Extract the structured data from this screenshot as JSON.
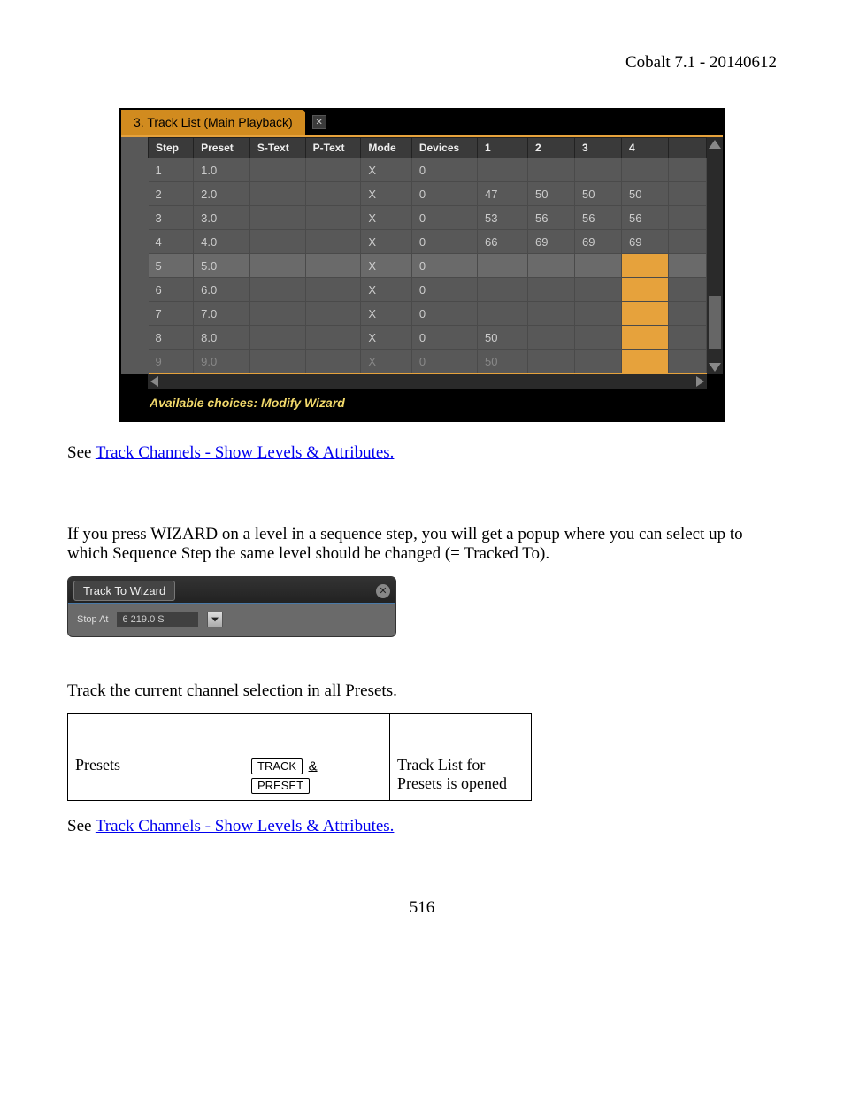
{
  "header": {
    "doc_id": "Cobalt 7.1 - 20140612"
  },
  "tracklist": {
    "title": "3. Track List (Main Playback)",
    "columns": [
      "Step",
      "Preset",
      "S-Text",
      "P-Text",
      "Mode",
      "Devices",
      "1",
      "2",
      "3",
      "4"
    ],
    "rows": [
      {
        "step": "1",
        "preset": "1.0",
        "stext": "",
        "ptext": "",
        "mode": "X",
        "devices": "0",
        "c1": "",
        "c2": "",
        "c3": "",
        "c4": "",
        "selected": false,
        "hl4": false
      },
      {
        "step": "2",
        "preset": "2.0",
        "stext": "",
        "ptext": "",
        "mode": "X",
        "devices": "0",
        "c1": "47",
        "c2": "50",
        "c3": "50",
        "c4": "50",
        "selected": false,
        "hl4": false
      },
      {
        "step": "3",
        "preset": "3.0",
        "stext": "",
        "ptext": "",
        "mode": "X",
        "devices": "0",
        "c1": "53",
        "c2": "56",
        "c3": "56",
        "c4": "56",
        "selected": false,
        "hl4": false
      },
      {
        "step": "4",
        "preset": "4.0",
        "stext": "",
        "ptext": "",
        "mode": "X",
        "devices": "0",
        "c1": "66",
        "c2": "69",
        "c3": "69",
        "c4": "69",
        "selected": false,
        "hl4": false
      },
      {
        "step": "5",
        "preset": "5.0",
        "stext": "",
        "ptext": "",
        "mode": "X",
        "devices": "0",
        "c1": "",
        "c2": "",
        "c3": "",
        "c4": "",
        "selected": true,
        "hl4": true
      },
      {
        "step": "6",
        "preset": "6.0",
        "stext": "",
        "ptext": "",
        "mode": "X",
        "devices": "0",
        "c1": "",
        "c2": "",
        "c3": "",
        "c4": "",
        "selected": false,
        "hl4": true
      },
      {
        "step": "7",
        "preset": "7.0",
        "stext": "",
        "ptext": "",
        "mode": "X",
        "devices": "0",
        "c1": "",
        "c2": "",
        "c3": "",
        "c4": "",
        "selected": false,
        "hl4": true
      },
      {
        "step": "8",
        "preset": "8.0",
        "stext": "",
        "ptext": "",
        "mode": "X",
        "devices": "0",
        "c1": "50",
        "c2": "",
        "c3": "",
        "c4": "",
        "selected": false,
        "hl4": true
      },
      {
        "step": "9",
        "preset": "9.0",
        "stext": "",
        "ptext": "",
        "mode": "X",
        "devices": "0",
        "c1": "50",
        "c2": "",
        "c3": "",
        "c4": "",
        "selected": false,
        "hl4": true,
        "last": true
      }
    ],
    "footer": "Available choices: Modify Wizard"
  },
  "paragraphs": {
    "see_prefix": "See ",
    "see_link": "Track Channels - Show Levels & Attributes.",
    "wizard_intro": "If you press WIZARD on a level in a sequence step, you will get a popup where you can select up to which Sequence Step the same level should be changed (= Tracked To).",
    "presets_intro": "Track the current channel selection in all Presets."
  },
  "wizard_dialog": {
    "title": "Track To Wizard",
    "label": "Stop At",
    "value": "6  219.0 S"
  },
  "action_table": {
    "row_label": "Presets",
    "key1": "TRACK",
    "amp": "&",
    "key2": "PRESET",
    "result": "Track List for Presets is opened"
  },
  "page_number": "516"
}
